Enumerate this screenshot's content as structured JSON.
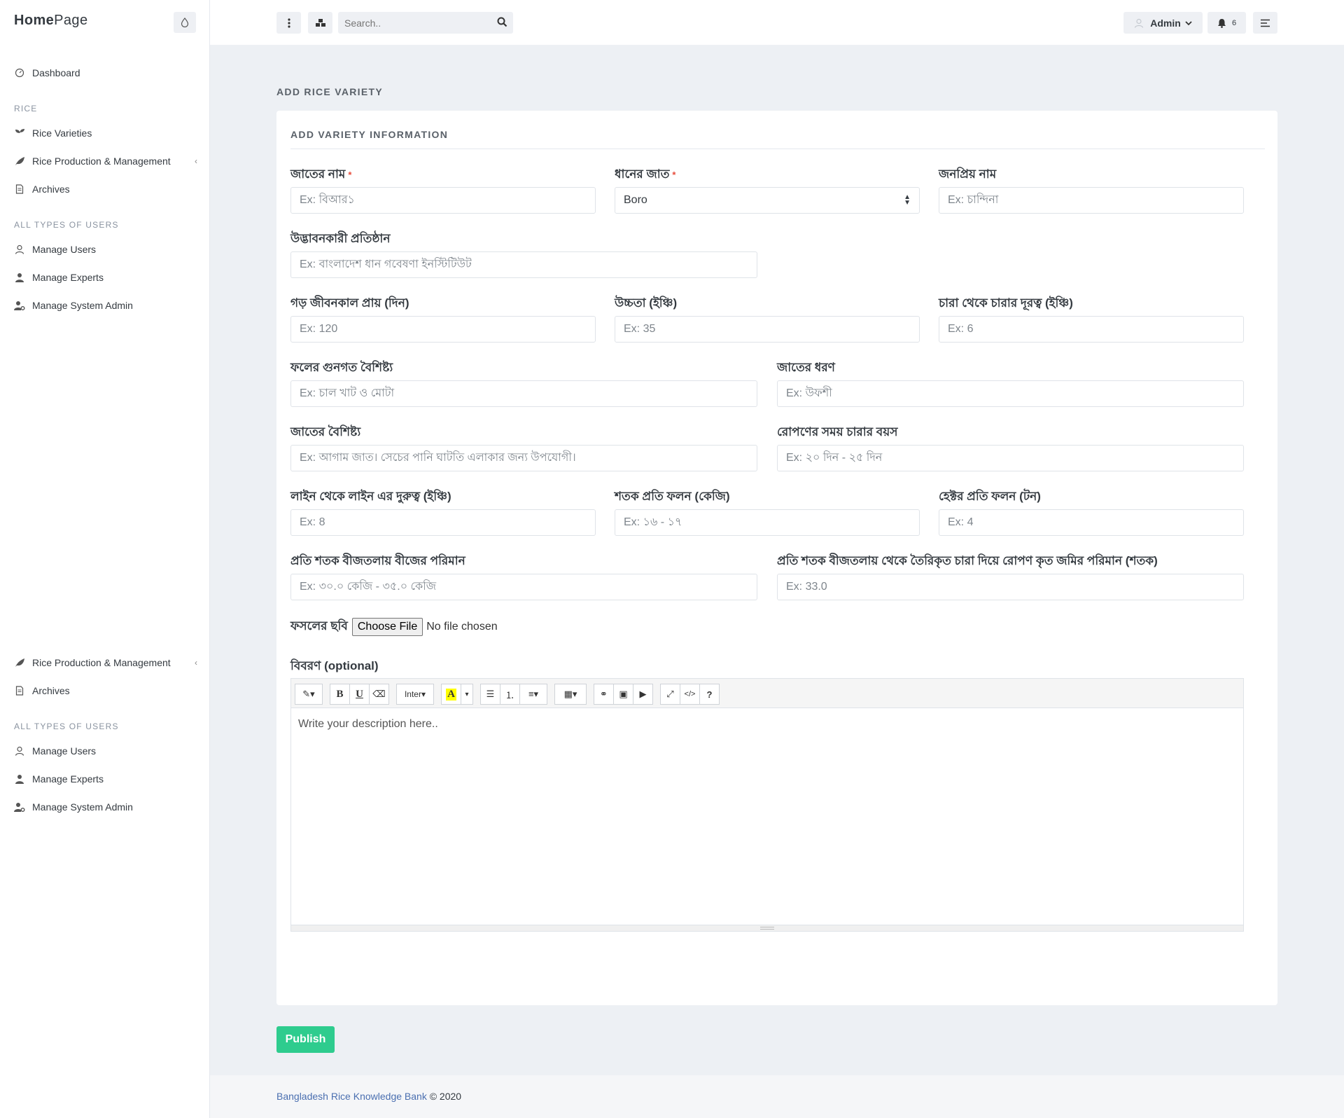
{
  "brand": {
    "part1": "Home",
    "part2": "Page"
  },
  "sidebar": {
    "groupA": {
      "dashboard": "Dashboard",
      "section_rice": "RICE",
      "rice_varieties": "Rice Varieties",
      "rice_production": "Rice Production & Management",
      "archives": "Archives",
      "section_users": "ALL TYPES OF USERS",
      "manage_users": "Manage Users",
      "manage_experts": "Manage Experts",
      "manage_admin": "Manage System Admin"
    },
    "groupB": {
      "rice_production": "Rice Production & Management",
      "archives": "Archives",
      "section_users": "ALL TYPES OF USERS",
      "manage_users": "Manage Users",
      "manage_experts": "Manage Experts",
      "manage_admin": "Manage System Admin"
    }
  },
  "topbar": {
    "search_placeholder": "Search..",
    "admin_label": "Admin",
    "notification_count": "6"
  },
  "page": {
    "title": "ADD RICE VARIETY",
    "card_title": "ADD VARIETY INFORMATION"
  },
  "form": {
    "variety_name": {
      "label": "জাতের নাম",
      "required": "*",
      "placeholder": "Ex: বিআর১"
    },
    "paddy_type": {
      "label": "ধানের জাত",
      "required": "*",
      "value": "Boro"
    },
    "popular_name": {
      "label": "জনপ্রিয় নাম",
      "placeholder": "Ex: চান্দিনা"
    },
    "inventor": {
      "label": "উদ্ভাবনকারী প্রতিষ্ঠান",
      "placeholder": "Ex: বাংলাদেশ ধান গবেষণা ইনস্টিটিউট"
    },
    "lifespan": {
      "label": "গড় জীবনকাল প্রায় (দিন)",
      "placeholder": "Ex: 120"
    },
    "height": {
      "label": "উচ্চতা (ইঞ্চি)",
      "placeholder": "Ex: 35"
    },
    "seedling_distance": {
      "label": "চারা থেকে চারার দূরত্ব (ইঞ্চি)",
      "placeholder": "Ex: 6"
    },
    "grain_quality": {
      "label": "ফলের গুনগত বৈশিষ্ট্য",
      "placeholder": "Ex: চাল খাট ও মোটা"
    },
    "variety_type": {
      "label": "জাতের ধরণ",
      "placeholder": "Ex: উফশী"
    },
    "variety_feature": {
      "label": "জাতের বৈশিষ্ট্য",
      "placeholder": "Ex: আগাম জাত। সেচের পানি ঘাটতি এলাকার জন্য উপযোগী।"
    },
    "seedling_age": {
      "label": "রোপণের সময় চারার বয়স",
      "placeholder": "Ex: ২০ দিন - ২৫ দিন"
    },
    "line_distance": {
      "label": "লাইন থেকে লাইন এর দুরুত্ব (ইঞ্চি)",
      "placeholder": "Ex: 8"
    },
    "yield_per_shotok": {
      "label": "শতক প্রতি ফলন (কেজি)",
      "placeholder": "Ex: ১৬ - ১৭"
    },
    "yield_per_hectare": {
      "label": "হেক্টর প্রতি ফলন (টন)",
      "placeholder": "Ex: 4"
    },
    "seed_amount": {
      "label": "প্রতি শতক বীজতলায় বীজের পরিমান",
      "placeholder": "Ex: ৩০.০ কেজি - ৩৫.০ কেজি"
    },
    "planted_land": {
      "label": "প্রতি শতক বীজতলায় থেকে তৈরিকৃত চারা দিয়ে রোপণ কৃত জমির পরিমান (শতক)",
      "placeholder": "Ex: 33.0"
    },
    "crop_image": {
      "label": "ফসলের ছবি",
      "button": "Choose File",
      "status": "No file chosen"
    },
    "description": {
      "label": "বিবরণ (optional)",
      "placeholder": "Write your description here..",
      "font_dropdown": "Inter"
    }
  },
  "publish_label": "Publish",
  "footer": {
    "link": "Bangladesh Rice Knowledge Bank",
    "suffix": " © 2020"
  },
  "colors": {
    "accent": "#2ecc8e",
    "required": "#e74c3c",
    "link": "#4a6fb0"
  }
}
